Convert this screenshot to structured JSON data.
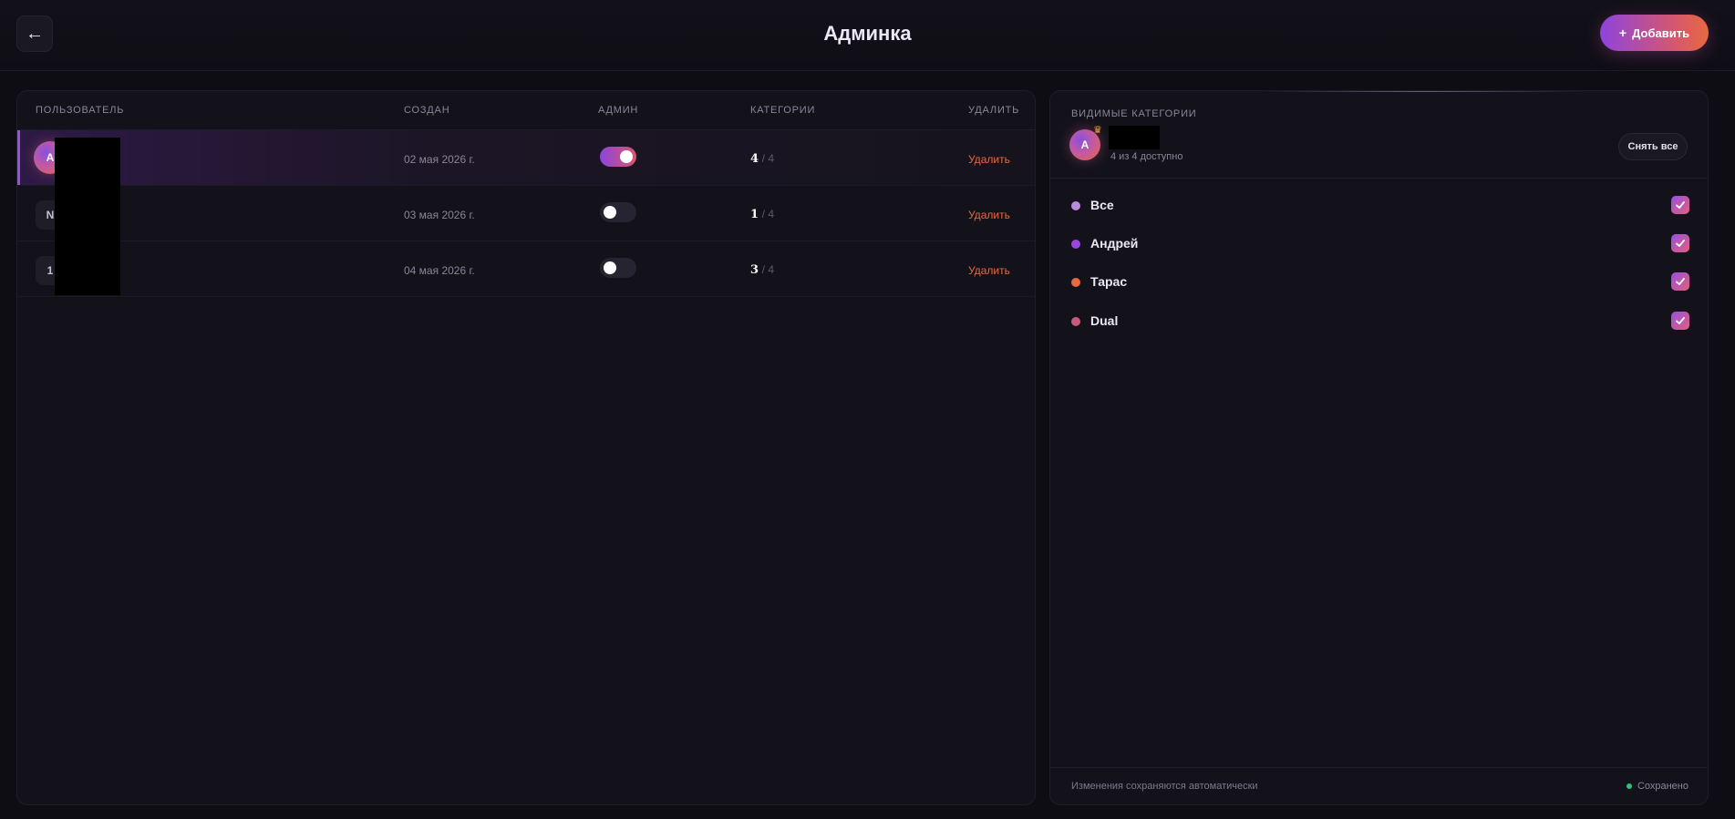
{
  "header": {
    "back_icon": "←",
    "title": "Админка",
    "add_label": "Добавить",
    "add_icon": "+"
  },
  "table": {
    "columns": {
      "user": "ПОЛЬЗОВАТЕЛЬ",
      "created": "СОЗДАН",
      "admin": "АДМИН",
      "categories": "КАТЕГОРИИ",
      "delete": "УДАЛИТЬ"
    },
    "rows": [
      {
        "initial": "A",
        "created": "02 мая 2026 г.",
        "admin": true,
        "cat_count": "4",
        "cat_total": "/ 4",
        "delete_label": "Удалить"
      },
      {
        "initial": "N",
        "created": "03 мая 2026 г.",
        "admin": false,
        "cat_count": "1",
        "cat_total": "/ 4",
        "delete_label": "Удалить"
      },
      {
        "initial": "1",
        "created": "04 мая 2026 г.",
        "admin": false,
        "cat_count": "3",
        "cat_total": "/ 4",
        "delete_label": "Удалить"
      }
    ]
  },
  "categories_panel": {
    "title": "ВИДИМЫЕ КАТЕГОРИИ",
    "user_initial": "A",
    "available_text": "4 из 4 доступно",
    "clear_all_label": "Снять все",
    "items": [
      {
        "name": "Все",
        "color": "#b98be0",
        "checked": true
      },
      {
        "name": "Андрей",
        "color": "#9b45e0",
        "checked": true
      },
      {
        "name": "Тарас",
        "color": "#e8683f",
        "checked": true
      },
      {
        "name": "Dual",
        "color": "#c95a7a",
        "checked": true
      }
    ],
    "footer_note": "Изменения сохраняются автоматически",
    "saved_label": "Сохранено"
  },
  "colors": {
    "accent_purple": "#8e44dd",
    "accent_orange": "#e8683f",
    "saved_green": "#2ec27e"
  }
}
